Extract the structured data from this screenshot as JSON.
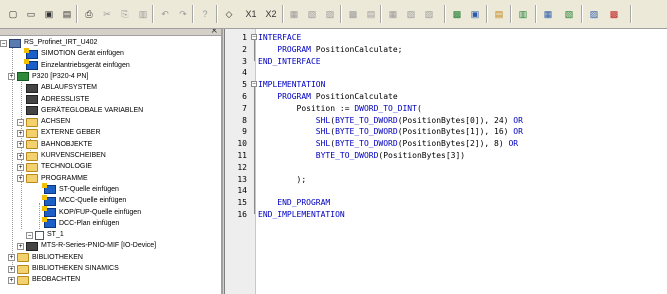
{
  "toolbar": {
    "icons": [
      "new-file-icon",
      "open-folder-icon",
      "save-icon",
      "save-all-icon",
      "print-icon",
      "cut-icon",
      "copy-icon",
      "paste-icon",
      "undo-icon",
      "redo-icon",
      "help-cursor-icon",
      "compare-icon",
      "subscript-icon",
      "superscript-icon",
      "toolbar-icon-a",
      "toolbar-icon-b",
      "toolbar-icon-c",
      "toolbar-icon-d",
      "toolbar-icon-e",
      "toolbar-icon-f",
      "toolbar-icon-g",
      "toolbar-icon-h",
      "toolbar-icon-i",
      "toolbar-icon-j",
      "toolbar-icon-k",
      "toolbar-icon-l",
      "toolbar-icon-m",
      "toolbar-icon-n",
      "toolbar-icon-o",
      "toolbar-icon-p"
    ],
    "x1": "X1",
    "x2": "X2",
    "close_glyph": "×"
  },
  "tree": {
    "items": [
      {
        "label": "RS_Profinet_IRT_U402",
        "icon": "project-icon"
      },
      {
        "label": "SIMOTION Gerät einfügen",
        "icon": "insert-device-icon"
      },
      {
        "label": "Einzelantriebsgerät einfügen",
        "icon": "insert-device-icon"
      },
      {
        "label": "P320 [P320-4 PN]",
        "icon": "cpu-icon"
      },
      {
        "label": "ABLAUFSYSTEM",
        "icon": "execution-system-icon"
      },
      {
        "label": "ADRESSLISTE",
        "icon": "address-list-icon"
      },
      {
        "label": "GERÄTEGLOBALE VARIABLEN",
        "icon": "global-variables-icon"
      },
      {
        "label": "ACHSEN",
        "icon": "folder-icon"
      },
      {
        "label": "EXTERNE GEBER",
        "icon": "folder-icon"
      },
      {
        "label": "BAHNOBJEKTE",
        "icon": "folder-icon"
      },
      {
        "label": "KURVENSCHEIBEN",
        "icon": "folder-icon"
      },
      {
        "label": "TECHNOLOGIE",
        "icon": "folder-icon"
      },
      {
        "label": "PROGRAMME",
        "icon": "folder-open-icon"
      },
      {
        "label": "ST-Quelle einfügen",
        "icon": "insert-icon"
      },
      {
        "label": "MCC-Quelle einfügen",
        "icon": "insert-icon"
      },
      {
        "label": "KOP/FUP-Quelle einfügen",
        "icon": "insert-icon"
      },
      {
        "label": "DCC-Plan einfügen",
        "icon": "insert-icon"
      },
      {
        "label": "ST_1",
        "icon": "source-file-icon"
      },
      {
        "label": "MTS-R-Series-PNIO-MIF [IO-Device]",
        "icon": "io-device-icon"
      },
      {
        "label": "BIBLIOTHEKEN",
        "icon": "folder-icon"
      },
      {
        "label": "BIBLIOTHEKEN SINAMICS",
        "icon": "folder-icon"
      },
      {
        "label": "BEOBACHTEN",
        "icon": "folder-icon"
      }
    ],
    "expanders": [
      "−",
      "+",
      "−",
      "+",
      "+",
      "+",
      "+",
      "+",
      "−",
      "+",
      "+",
      "+",
      "+",
      "+"
    ]
  },
  "editor": {
    "line_numbers": [
      "1",
      "2",
      "3",
      "4",
      "5",
      "6",
      "7",
      "8",
      "9",
      "10",
      "11",
      "12",
      "13",
      "14",
      "15",
      "16"
    ],
    "fold_markers": [
      "−",
      "−"
    ],
    "lines": [
      [
        {
          "t": "INTERFACE",
          "k": true
        }
      ],
      [
        {
          "t": "    PROGRAM",
          "k": true
        },
        {
          "t": " PositionCalculate;",
          "k": false
        }
      ],
      [
        {
          "t": "END_INTERFACE",
          "k": true
        }
      ],
      [],
      [
        {
          "t": "IMPLEMENTATION",
          "k": true
        }
      ],
      [
        {
          "t": "    PROGRAM",
          "k": true
        },
        {
          "t": " PositionCalculate",
          "k": false
        }
      ],
      [
        {
          "t": "        Position := ",
          "k": false
        },
        {
          "t": "DWORD_TO_DINT",
          "k": true
        },
        {
          "t": "(",
          "k": false
        }
      ],
      [
        {
          "t": "            SHL",
          "k": true
        },
        {
          "t": "(",
          "k": false
        },
        {
          "t": "BYTE_TO_DWORD",
          "k": true
        },
        {
          "t": "(PositionBytes[0]), 24) ",
          "k": false
        },
        {
          "t": "OR",
          "k": true
        }
      ],
      [
        {
          "t": "            SHL",
          "k": true
        },
        {
          "t": "(",
          "k": false
        },
        {
          "t": "BYTE_TO_DWORD",
          "k": true
        },
        {
          "t": "(PositionBytes[1]), 16) ",
          "k": false
        },
        {
          "t": "OR",
          "k": true
        }
      ],
      [
        {
          "t": "            SHL",
          "k": true
        },
        {
          "t": "(",
          "k": false
        },
        {
          "t": "BYTE_TO_DWORD",
          "k": true
        },
        {
          "t": "(PositionBytes[2]), 8) ",
          "k": false
        },
        {
          "t": "OR",
          "k": true
        }
      ],
      [
        {
          "t": "            BYTE_TO_DWORD",
          "k": true
        },
        {
          "t": "(PositionBytes[3])",
          "k": false
        }
      ],
      [],
      [
        {
          "t": "        );",
          "k": false
        }
      ],
      [],
      [
        {
          "t": "    END_PROGRAM",
          "k": true
        }
      ],
      [
        {
          "t": "END_IMPLEMENTATION",
          "k": true
        }
      ]
    ]
  },
  "colors": {
    "keyword": "#0000c0",
    "text": "#000000",
    "folder": "#f3d16e"
  }
}
